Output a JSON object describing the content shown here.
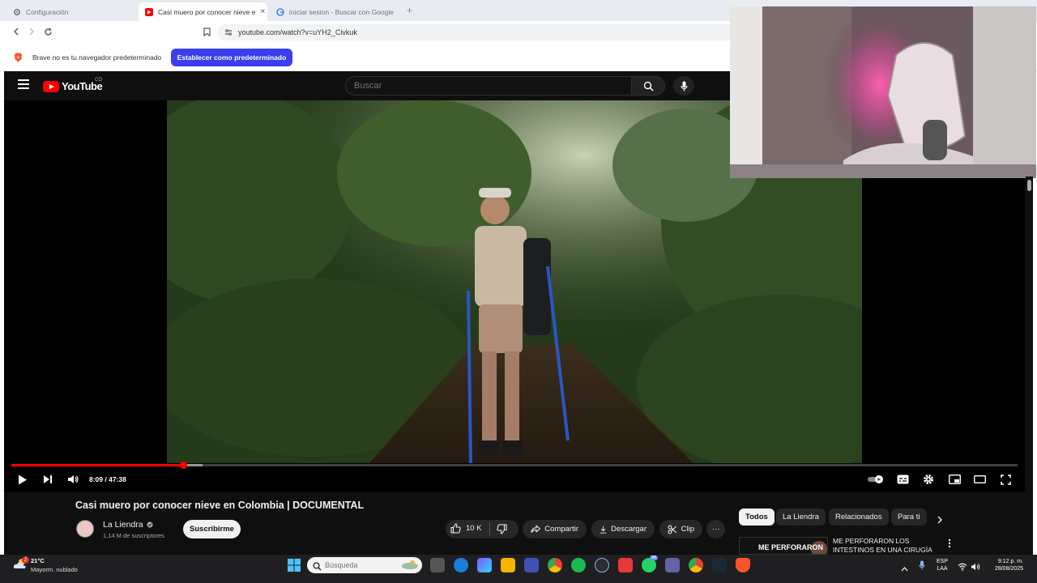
{
  "browser": {
    "tabs": [
      {
        "title": "Configuración",
        "icon": "gear-icon"
      },
      {
        "title": "Casi muero por conocer nieve e",
        "icon": "youtube-icon"
      },
      {
        "title": "iniciar sesion - Buscar con Google",
        "icon": "google-icon"
      }
    ],
    "new_tab": "+",
    "close_tab": "×",
    "url": "youtube.com/watch?v=uYH2_Civkuk",
    "infobar_text": "Brave no es tu navegador predeterminado",
    "infobar_button": "Establecer como predeterminado"
  },
  "youtube": {
    "logo_text": "YouTube",
    "country": "CO",
    "search_placeholder": "Buscar",
    "player": {
      "time": "8:09 / 47:38",
      "progress": 0.171
    },
    "video_title": "Casi muero por conocer nieve en Colombia | DOCUMENTAL",
    "channel": {
      "name": "La Liendra",
      "subscribers": "1,14 M de suscriptores",
      "subscribe_label": "Suscribirme"
    },
    "actions": {
      "likes": "10 K",
      "share": "Compartir",
      "download": "Descargar",
      "clip": "Clip",
      "more": "···"
    },
    "chips": [
      "Todos",
      "La Liendra",
      "Relacionados",
      "Para ti"
    ],
    "recommendation": {
      "thumb_text": "ME PERFORARON",
      "title": "ME PERFORARON LOS INTESTINOS EN UNA CIRUGÍA"
    }
  },
  "taskbar": {
    "weather_temp": "21°C",
    "weather_desc": "Mayorm. nublado",
    "weather_badge": "2",
    "search_placeholder": "Búsqueda",
    "lang_line1": "ESP",
    "lang_line2": "LAA",
    "time": "9:12 p. m.",
    "date": "28/08/2025",
    "badge_count": "88"
  },
  "colors": {
    "youtube_red": "#ff0000",
    "brave_button": "#3b3ef0",
    "yt_background": "#0f0f0f"
  }
}
